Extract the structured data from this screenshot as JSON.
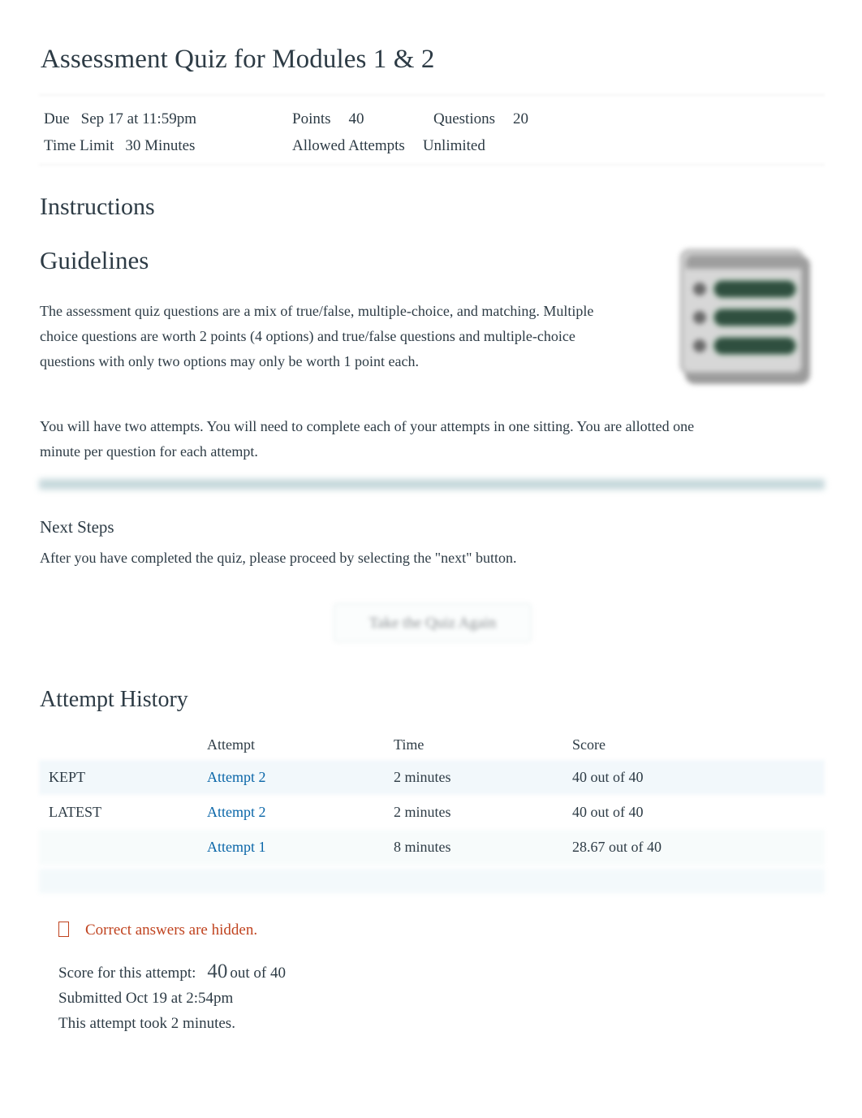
{
  "quiz": {
    "title": "Assessment Quiz for Modules 1 & 2",
    "meta": {
      "due_label": "Due",
      "due_value": "Sep 17 at 11:59pm",
      "points_label": "Points",
      "points_value": "40",
      "questions_label": "Questions",
      "questions_value": "20",
      "time_limit_label": "Time Limit",
      "time_limit_value": "30 Minutes",
      "allowed_attempts_label": "Allowed Attempts",
      "allowed_attempts_value": "Unlimited"
    }
  },
  "instructions": {
    "heading": "Instructions",
    "guidelines_heading": "Guidelines",
    "paragraph_1": "The assessment quiz questions are a mix of true/false, multiple-choice, and matching. Multiple choice questions are worth 2 points (4 options) and true/false questions and multiple-choice questions with only two options may only be worth 1 point each.",
    "paragraph_2": "You will have two attempts. You will need to complete each of your attempts in one sitting. You are allotted one minute per question for each attempt.",
    "next_steps_heading": "Next Steps",
    "next_steps_text": "After you have completed the quiz, please proceed by selecting the \"next\" button.",
    "checklist_icon_name": "checklist-icon"
  },
  "actions": {
    "take_quiz_again": "Take the Quiz Again"
  },
  "attempt_history": {
    "heading": "Attempt History",
    "columns": [
      "",
      "Attempt",
      "Time",
      "Score"
    ],
    "rows": [
      {
        "status": "KEPT",
        "attempt": "Attempt 2",
        "time": "2 minutes",
        "score": "40 out of 40"
      },
      {
        "status": "LATEST",
        "attempt": "Attempt 2",
        "time": "2 minutes",
        "score": "40 out of 40"
      },
      {
        "status": "",
        "attempt": "Attempt 1",
        "time": "8 minutes",
        "score": "28.67 out of 40"
      }
    ]
  },
  "result": {
    "hidden_notice": "Correct answers are hidden.",
    "hidden_notice_icon": "info-tofu-icon",
    "score_label": "Score for this attempt:",
    "score_value": "40",
    "score_out_of": "out of 40",
    "submitted": "Submitted Oct 19 at 2:54pm",
    "duration": "This attempt took 2 minutes."
  },
  "colors": {
    "link": "#0a66a8",
    "notice": "#c0431f",
    "rule_teal": "#c3d6da",
    "text": "#2d3b45"
  }
}
